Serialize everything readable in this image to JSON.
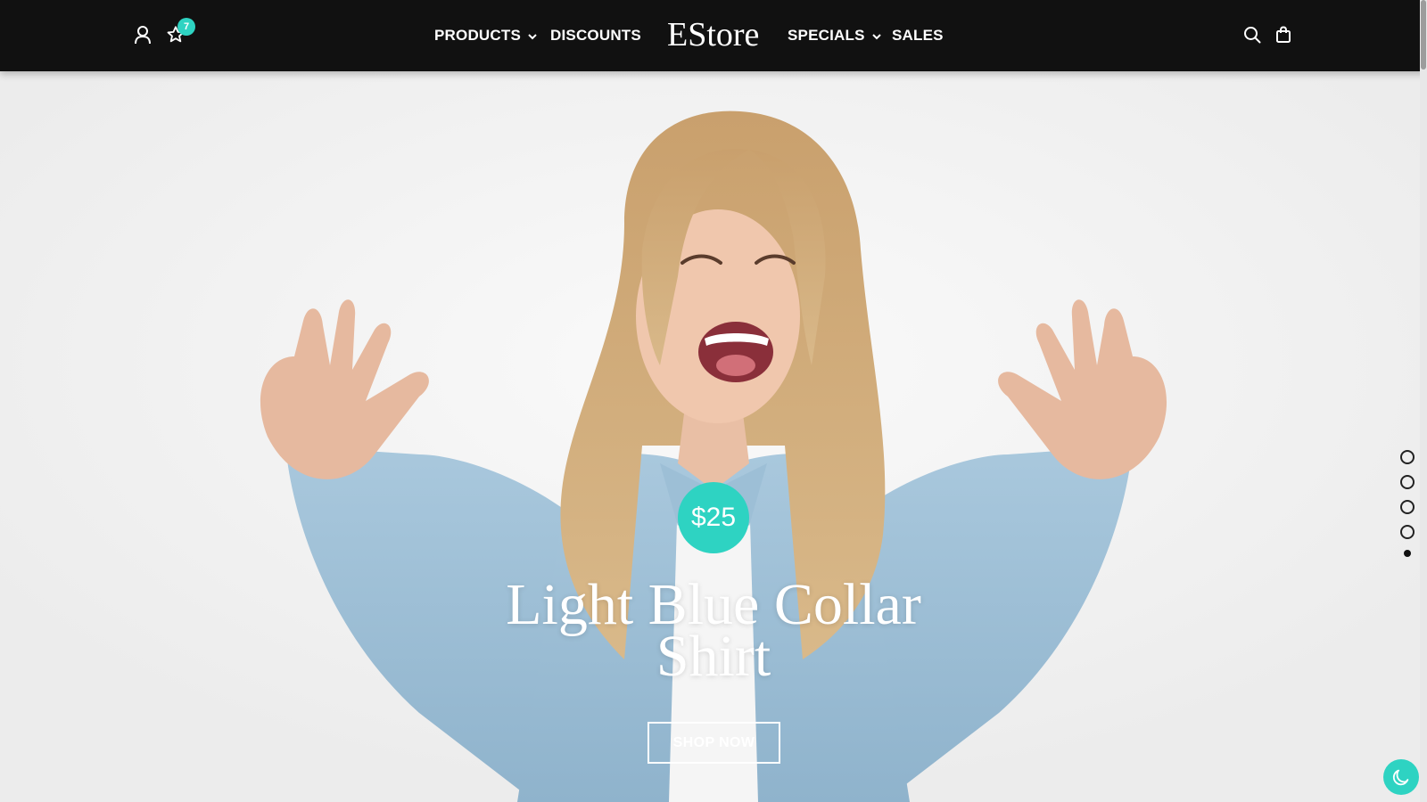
{
  "header": {
    "brand": "EStore",
    "wishlist_count": "7",
    "nav_left": [
      {
        "label": "PRODUCTS",
        "has_dropdown": true
      },
      {
        "label": "DISCOUNTS",
        "has_dropdown": false
      }
    ],
    "nav_right": [
      {
        "label": "SPECIALS",
        "has_dropdown": true
      },
      {
        "label": "SALES",
        "has_dropdown": false
      }
    ],
    "icons": [
      "user-icon",
      "star-icon",
      "search-icon",
      "shopping-bag-icon"
    ]
  },
  "hero": {
    "price": "$25",
    "title_line1": "Light Blue Collar",
    "title_line2": "Shirt",
    "cta_label": "SHOP NOW",
    "slides_total": 5,
    "active_slide": 5
  },
  "colors": {
    "header_bg": "#111111",
    "accent": "#2ed3c2",
    "text_light": "#ffffff"
  },
  "dark_mode_toggle": {
    "icon": "moon-icon"
  }
}
